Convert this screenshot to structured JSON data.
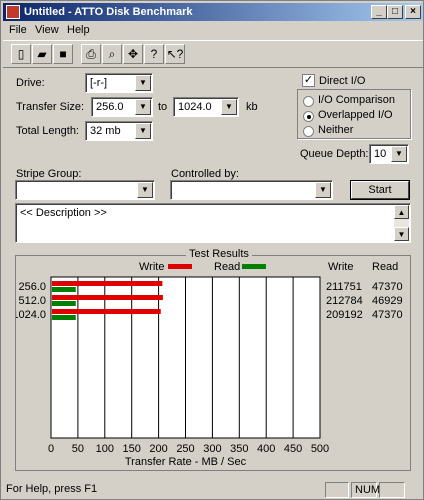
{
  "window": {
    "title": "Untitled - ATTO Disk Benchmark"
  },
  "menu": [
    "File",
    "View",
    "Help"
  ],
  "form": {
    "drive_label": "Drive:",
    "drive_value": "[-r-]",
    "transfer_label": "Transfer Size:",
    "transfer_from": "256.0",
    "to_label": "to",
    "transfer_to": "1024.0",
    "kb_label": "kb",
    "total_label": "Total Length:",
    "total_value": "32 mb",
    "direct_io": "Direct I/O",
    "io_comparison": "I/O Comparison",
    "overlapped_io": "Overlapped I/O",
    "neither": "Neither",
    "queue_label": "Queue Depth:",
    "queue_value": "10",
    "stripe_label": "Stripe Group:",
    "controlled_label": "Controlled by:",
    "start_button": "Start",
    "description": "<< Description >>"
  },
  "results": {
    "legend_title": "Test Results",
    "write_label": "Write",
    "read_label": "Read",
    "write_col": "Write",
    "read_col": "Read",
    "colors": {
      "write": "#e00000",
      "read": "#008000"
    },
    "rows": [
      {
        "size": "256.0",
        "write": "211751",
        "read": "47370"
      },
      {
        "size": "512.0",
        "write": "212784",
        "read": "46929"
      },
      {
        "size": "1024.0",
        "write": "209192",
        "read": "47370"
      }
    ]
  },
  "chart_data": {
    "type": "bar",
    "categories": [
      "256.0",
      "512.0",
      "1024.0"
    ],
    "series": [
      {
        "name": "Write",
        "values": [
          207,
          208,
          204
        ]
      },
      {
        "name": "Read",
        "values": [
          46,
          46,
          46
        ]
      }
    ],
    "xlabel": "Transfer Rate - MB / Sec",
    "xticks": [
      "0",
      "50",
      "100",
      "150",
      "200",
      "250",
      "300",
      "350",
      "400",
      "450",
      "500"
    ],
    "xlim": [
      0,
      500
    ],
    "grid": true
  },
  "status": {
    "help": "For Help, press F1",
    "num": "NUM"
  }
}
